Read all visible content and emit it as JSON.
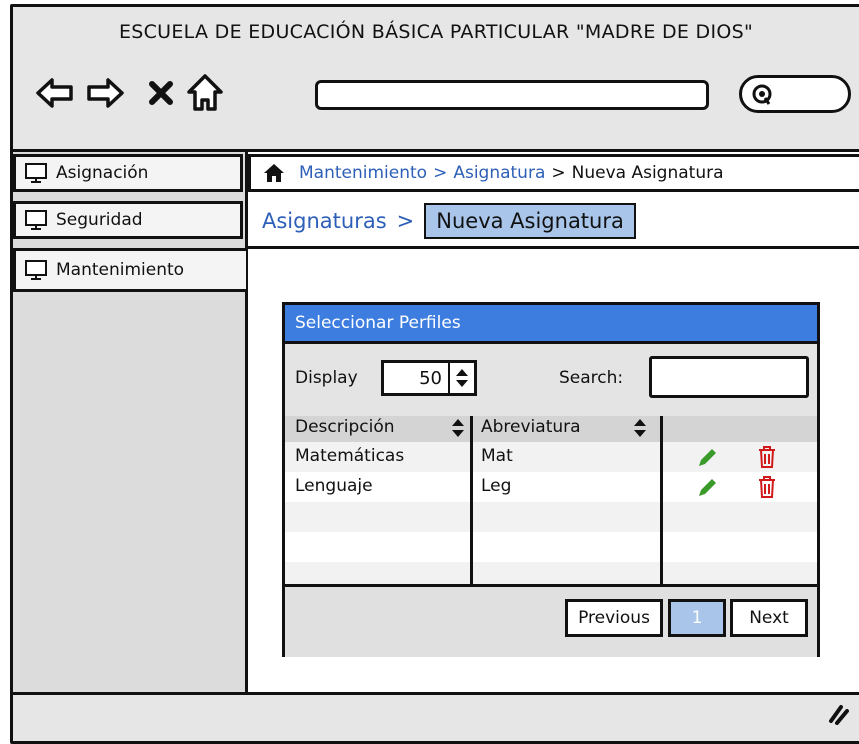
{
  "app": {
    "title": "ESCUELA DE EDUCACIÓN BÁSICA PARTICULAR \"MADRE DE DIOS\""
  },
  "nav": {
    "back": "back-arrow-icon",
    "forward": "forward-arrow-icon",
    "close": "close-icon",
    "home": "home-icon",
    "search": "search-icon",
    "url": ""
  },
  "sidebar": {
    "items": [
      {
        "label": "Asignación",
        "icon": "monitor-icon"
      },
      {
        "label": "Seguridad",
        "icon": "monitor-icon"
      },
      {
        "label": "Mantenimiento",
        "icon": "monitor-icon"
      }
    ]
  },
  "breadcrumb": {
    "items": [
      "Mantenimiento",
      "Asignatura",
      "Nueva Asignatura"
    ],
    "sep": ">"
  },
  "header": {
    "link": "Asignaturas",
    "sep": ">",
    "current": "Nueva Asignatura"
  },
  "panel": {
    "title": "Seleccionar Perfiles",
    "display_label": "Display",
    "display_value": "50",
    "search_label": "Search:",
    "search_value": "",
    "columns": [
      "Descripción",
      "Abreviatura",
      ""
    ],
    "rows": [
      {
        "descripcion": "Matemáticas",
        "abreviatura": "Mat"
      },
      {
        "descripcion": "Lenguaje",
        "abreviatura": "Leg"
      }
    ],
    "pager": {
      "previous": "Previous",
      "page": "1",
      "next": "Next"
    }
  },
  "colors": {
    "accent": "#3d7de0",
    "link": "#2d5fb8",
    "selected": "#a9c6ea",
    "edit": "#3a9a2a",
    "delete": "#d11a1a"
  }
}
